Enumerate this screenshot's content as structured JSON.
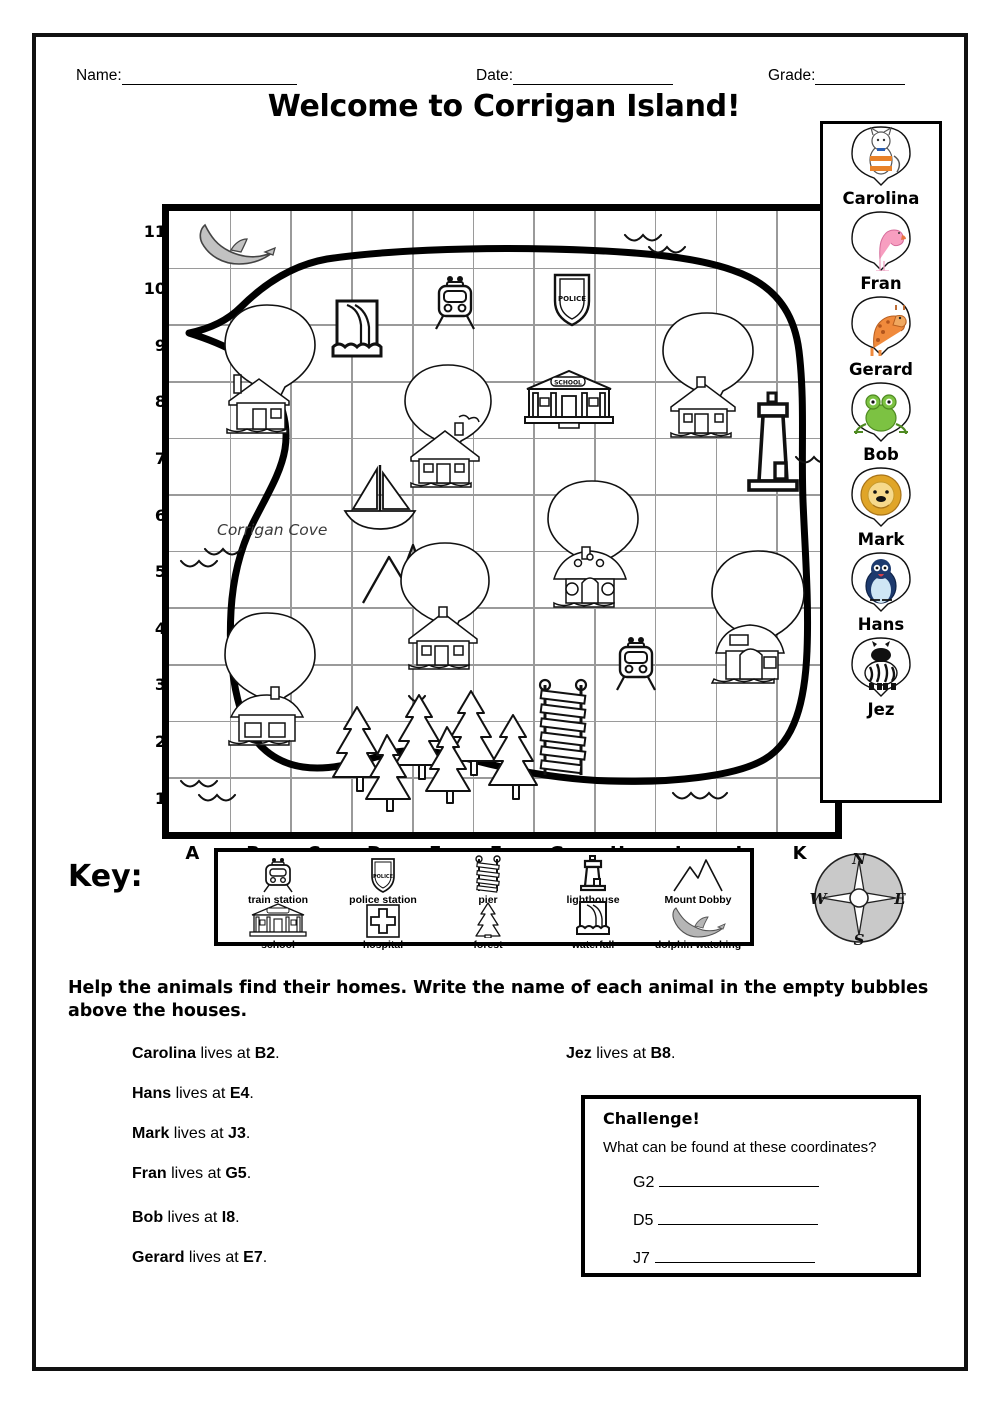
{
  "header": {
    "name_label": "Name:",
    "date_label": "Date:",
    "grade_label": "Grade:"
  },
  "title": "Welcome to Corrigan Island!",
  "map": {
    "cove_label": "Corrigan Cove",
    "x_axis": [
      "A",
      "B",
      "C",
      "D",
      "E",
      "F",
      "G",
      "H",
      "I",
      "J",
      "K"
    ],
    "y_axis": [
      "11",
      "10",
      "9",
      "8",
      "7",
      "6",
      "5",
      "4",
      "3",
      "2",
      "1"
    ]
  },
  "animals": [
    {
      "name": "Carolina",
      "icon": "cat-icon"
    },
    {
      "name": "Fran",
      "icon": "flamingo-icon"
    },
    {
      "name": "Gerard",
      "icon": "giraffe-icon"
    },
    {
      "name": "Bob",
      "icon": "frog-icon"
    },
    {
      "name": "Mark",
      "icon": "lion-icon"
    },
    {
      "name": "Hans",
      "icon": "penguin-icon"
    },
    {
      "name": "Jez",
      "icon": "zebra-icon"
    }
  ],
  "key": {
    "label": "Key:",
    "items": [
      {
        "label": "train station",
        "icon": "train-icon"
      },
      {
        "label": "police station",
        "icon": "police-badge-icon"
      },
      {
        "label": "pier",
        "icon": "pier-icon"
      },
      {
        "label": "lighthouse",
        "icon": "lighthouse-icon"
      },
      {
        "label": "Mount Dobby",
        "icon": "mountain-icon"
      },
      {
        "label": "school",
        "icon": "school-icon"
      },
      {
        "label": "hospital",
        "icon": "hospital-cross-icon"
      },
      {
        "label": "forest",
        "icon": "pine-tree-icon"
      },
      {
        "label": "waterfall",
        "icon": "waterfall-icon"
      },
      {
        "label": "dolphin watching",
        "icon": "dolphin-icon"
      }
    ]
  },
  "compass": {
    "north": "N",
    "south": "S",
    "east": "E",
    "west": "W"
  },
  "instructions": "Help the animals find their homes. Write the name of each animal in the empty bubbles above the houses.",
  "answers_left": [
    {
      "name": "Carolina",
      "mid": " lives at ",
      "coord": "B2",
      "end": "."
    },
    {
      "name": "Hans",
      "mid": " lives at ",
      "coord": "E4",
      "end": "."
    },
    {
      "name": "Mark",
      "mid": " lives at ",
      "coord": "J3",
      "end": "."
    },
    {
      "name": "Fran",
      "mid": " lives at ",
      "coord": "G5",
      "end": "."
    },
    {
      "name": "Bob",
      "mid": " lives at ",
      "coord": "I8",
      "end": "."
    },
    {
      "name": "Gerard",
      "mid": " lives at ",
      "coord": "E7",
      "end": "."
    }
  ],
  "answers_right": [
    {
      "name": "Jez",
      "mid": " lives at ",
      "coord": "B8",
      "end": "."
    }
  ],
  "challenge": {
    "title": "Challenge!",
    "question": "What can be found at these coordinates?",
    "coords": [
      "G2",
      "D5",
      "J7"
    ]
  },
  "colors": {
    "ink": "#000000",
    "grid": "#9a9a9a",
    "compass_fill": "#c9c9c9",
    "dolphin_fill": "#bfbfbf"
  }
}
